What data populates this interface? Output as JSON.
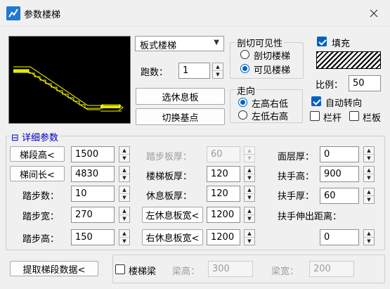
{
  "window": {
    "title": "参数楼梯"
  },
  "stair_type": {
    "selected": "板式楼梯"
  },
  "flights": {
    "label": "跑数：",
    "value": "1"
  },
  "buttons": {
    "select_landing": "选休息板",
    "switch_base_point": "切换基点",
    "flight_height": "梯段高<",
    "stair_width": "梯间长<",
    "left_landing_width": "左休息板宽<",
    "right_landing_width": "右休息板宽<",
    "extract_flight_data": "提取梯段数据<"
  },
  "section_visibility": {
    "label": "剖切可见性",
    "options": [
      {
        "label": "剖切楼梯",
        "selected": false
      },
      {
        "label": "可见楼梯",
        "selected": true
      }
    ]
  },
  "fill": {
    "label": "填充",
    "checked": true,
    "scale_label": "比例：",
    "scale_value": "50"
  },
  "direction": {
    "label": "走向",
    "options": [
      {
        "label": "左高右低",
        "selected": true
      },
      {
        "label": "左低右高",
        "selected": false
      }
    ]
  },
  "auto_turn": {
    "label": "自动转向",
    "checked": true
  },
  "railing": {
    "label": "栏杆",
    "checked": false
  },
  "rail_board": {
    "label": "栏板",
    "checked": false
  },
  "details": {
    "label": "详细参数",
    "collapse_glyph": "⊟",
    "flight_height_value": "1500",
    "stair_width_value": "4830",
    "steps_label": "踏步数：",
    "steps_value": "10",
    "tread_width_label": "踏步宽：",
    "tread_width_value": "270",
    "riser_height_label": "踏步高：",
    "riser_height_value": "150",
    "tread_thickness_label": "踏步板厚：",
    "tread_thickness_value": "60",
    "stair_slab_thickness_label": "楼梯板厚：",
    "stair_slab_thickness_value": "120",
    "landing_thickness_label": "休息板厚：",
    "landing_thickness_value": "120",
    "left_landing_width_value": "1200",
    "right_landing_width_value": "1200",
    "finish_thickness_label": "面层厚：",
    "finish_thickness_value": "0",
    "handrail_height_label": "扶手高：",
    "handrail_height_value": "900",
    "handrail_thickness_label": "扶手厚：",
    "handrail_thickness_value": "60",
    "handrail_extension_label": "扶手伸出距离：",
    "handrail_extension_value": "0"
  },
  "stair_beam": {
    "label": "楼梯梁",
    "checked": false,
    "beam_height_label": "梁高：",
    "beam_height_value": "300",
    "beam_width_label": "梁宽：",
    "beam_width_value": "200"
  },
  "colors": {
    "accent": "#0062c2",
    "preview_bg": "#000000",
    "preview_line": "#ffff00",
    "detail_label": "#0000c0"
  }
}
